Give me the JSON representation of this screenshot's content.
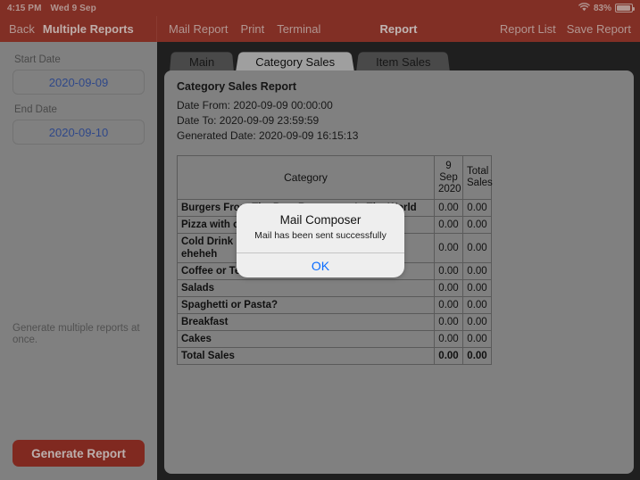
{
  "statusbar": {
    "time": "4:15 PM",
    "date": "Wed 9 Sep",
    "battery_percent": "83%",
    "wifi_icon": "wifi-icon",
    "battery_icon": "battery-icon"
  },
  "navbar": {
    "back_label": "Back",
    "sidebar_title": "Multiple Reports",
    "left_items": [
      {
        "label": "Mail Report",
        "name": "mail-report-button"
      },
      {
        "label": "Print",
        "name": "print-button"
      },
      {
        "label": "Terminal",
        "name": "terminal-button"
      }
    ],
    "center_title": "Report",
    "right_items": [
      {
        "label": "Report List",
        "name": "report-list-button"
      },
      {
        "label": "Save Report",
        "name": "save-report-button"
      }
    ]
  },
  "sidebar": {
    "start_date_label": "Start Date",
    "start_date_value": "2020-09-09",
    "end_date_label": "End Date",
    "end_date_value": "2020-09-10",
    "hint": "Generate multiple reports at once.",
    "generate_button": "Generate Report",
    "accent_color": "#9d3328",
    "date_text_color": "#3a58a8"
  },
  "tabs": [
    {
      "label": "Main",
      "active": false
    },
    {
      "label": "Category Sales",
      "active": true
    },
    {
      "label": "Item Sales",
      "active": false
    }
  ],
  "report": {
    "title": "Category Sales Report",
    "date_from": "Date From: 2020-09-09 00:00:00",
    "date_to": "Date To: 2020-09-09 23:59:59",
    "generated": "Generated Date: 2020-09-09 16:15:13",
    "columns": [
      "Category",
      "9 Sep 2020",
      "Total Sales"
    ],
    "column_day_lines": [
      "9",
      "Sep",
      "2020"
    ],
    "column_total_lines": [
      "Total",
      "Sales"
    ],
    "rows": [
      {
        "category": "Burgers From The Best Restaurant In The World",
        "day": "0.00",
        "total": "0.00"
      },
      {
        "category": "Pizza with category",
        "day": "0.00",
        "total": "0.00"
      },
      {
        "category": "Cold Drink heheheheh heheheheh heheheheh eheheh",
        "day": "0.00",
        "total": "0.00"
      },
      {
        "category": "Coffee or Tea",
        "day": "0.00",
        "total": "0.00"
      },
      {
        "category": "Salads",
        "day": "0.00",
        "total": "0.00"
      },
      {
        "category": "Spaghetti or Pasta?",
        "day": "0.00",
        "total": "0.00"
      },
      {
        "category": "Breakfast",
        "day": "0.00",
        "total": "0.00"
      },
      {
        "category": "Cakes",
        "day": "0.00",
        "total": "0.00"
      }
    ],
    "total_row": {
      "category": "Total Sales",
      "day": "0.00",
      "total": "0.00"
    }
  },
  "alert": {
    "title": "Mail Composer",
    "message": "Mail has been sent successfully",
    "ok_label": "OK",
    "ok_color": "#0a6cff"
  }
}
